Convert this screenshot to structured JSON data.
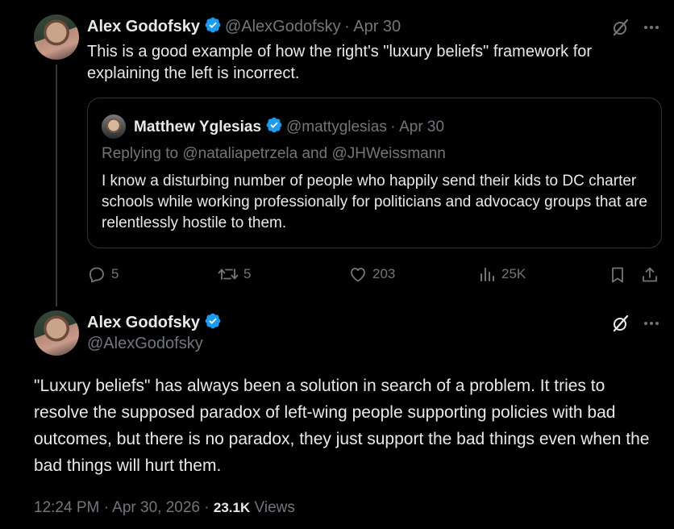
{
  "parent_tweet": {
    "author_name": "Alex Godofsky",
    "handle": "@AlexGodofsky",
    "separator": "·",
    "date": "Apr 30",
    "text": "This is a good example of how the right's \"luxury beliefs\" framework for explaining the left is incorrect.",
    "quoted": {
      "author_name": "Matthew Yglesias",
      "handle": "@mattyglesias",
      "separator": "·",
      "date": "Apr 30",
      "replying_to": "Replying to @nataliapetrzela and @JHWeissmann",
      "text": "I know a disturbing number of people who happily send their kids to DC charter schools while working professionally for politicians and advocacy groups that are relentlessly hostile to them."
    },
    "actions": {
      "replies": "5",
      "reposts": "5",
      "likes": "203",
      "views": "25K"
    }
  },
  "main_tweet": {
    "author_name": "Alex Godofsky",
    "handle": "@AlexGodofsky",
    "text": "\"Luxury beliefs\" has always been a solution in search of a problem. It tries to resolve the supposed paradox of left-wing people supporting policies with bad outcomes, but there is no paradox, they just support the bad things even when the bad things will hurt them.",
    "time": "12:24 PM",
    "sep1": "·",
    "date": "Apr 30, 2026",
    "sep2": "·",
    "views_count": "23.1K",
    "views_label": "Views"
  },
  "colors": {
    "background": "#000000",
    "text": "#e7e9ea",
    "muted": "#71767b",
    "verified": "#1d9bf0",
    "border": "#2f3336"
  },
  "icons": [
    "verified-badge-icon",
    "grok-icon",
    "more-icon",
    "reply-icon",
    "repost-icon",
    "like-icon",
    "views-icon",
    "bookmark-icon",
    "share-icon"
  ]
}
